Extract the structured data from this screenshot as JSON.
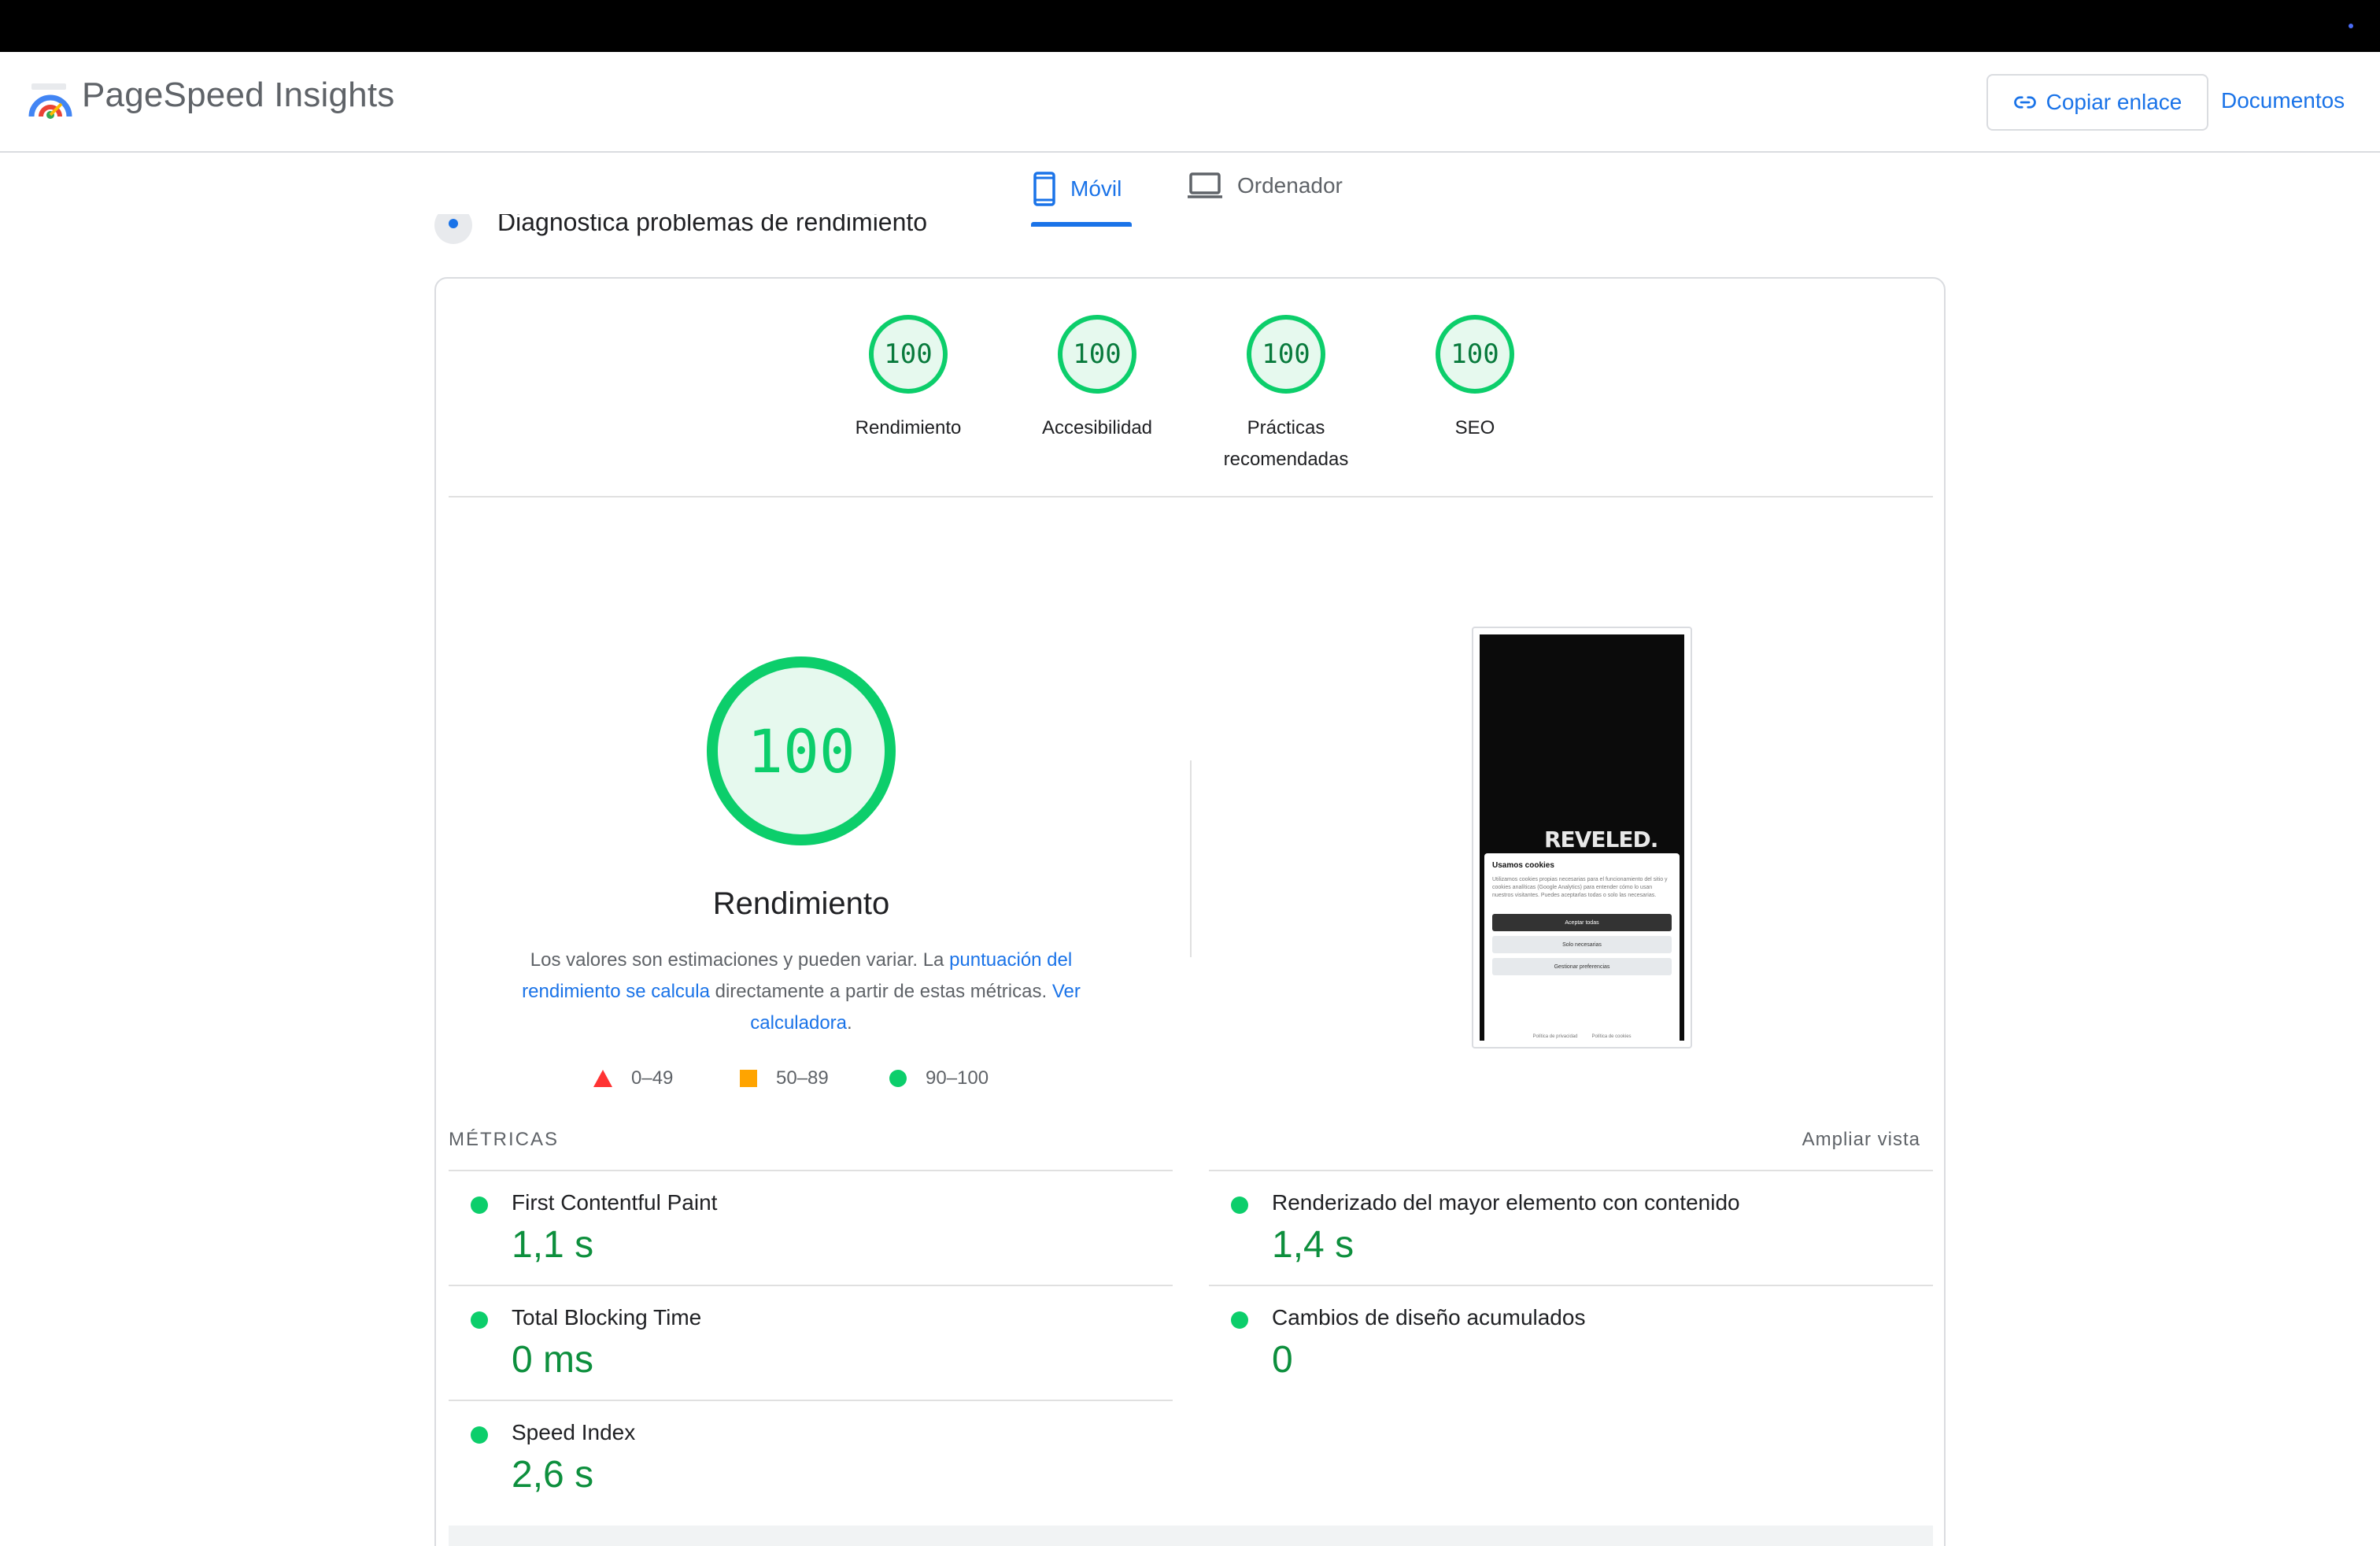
{
  "app": {
    "title": "PageSpeed Insights",
    "copy_link_label": "Copiar enlace",
    "docs_label": "Documentos"
  },
  "tabs": [
    {
      "label": "Móvil",
      "active": true,
      "icon": "smartphone-icon"
    },
    {
      "label": "Ordenador",
      "active": false,
      "icon": "laptop-icon"
    }
  ],
  "section_title": "Diagnostica problemas de rendimiento",
  "scores": [
    {
      "value": "100",
      "label": "Rendimiento"
    },
    {
      "value": "100",
      "label": "Accesibilidad"
    },
    {
      "value": "100",
      "label_line1": "Prácticas",
      "label_line2": "recomendadas"
    },
    {
      "value": "100",
      "label": "SEO"
    }
  ],
  "performance": {
    "score": "100",
    "title": "Rendimiento",
    "desc_part1": "Los valores son estimaciones y pueden variar. La ",
    "desc_link1": "puntuación del rendimiento se calcula",
    "desc_part2": " directamente a partir de estas métricas. ",
    "desc_link2": "Ver calculadora",
    "desc_part3": "."
  },
  "legend": [
    {
      "range": "0–49",
      "shape": "triangle",
      "color": "#ff3333"
    },
    {
      "range": "50–89",
      "shape": "square",
      "color": "#ffa400"
    },
    {
      "range": "90–100",
      "shape": "circle",
      "color": "#0cce6b"
    }
  ],
  "screenshot": {
    "brand": "REVELED.",
    "dialog_title": "Usamos cookies",
    "dialog_body": "Utilizamos cookies propias necesarias para el funcionamiento del sitio y cookies analíticas (Google Analytics) para entender cómo lo usan nuestros visitantes. Puedes aceptarlas todas o solo las necesarias.",
    "btn_accept": "Aceptar todas",
    "btn_necessary": "Solo necesarias",
    "btn_manage": "Gestionar preferencias",
    "link_privacy": "Política de privacidad",
    "link_cookies": "Política de cookies"
  },
  "metrics": {
    "title": "MÉTRICAS",
    "expand_label": "Ampliar vista",
    "left": [
      {
        "name": "First Contentful Paint",
        "value": "1,1 s"
      },
      {
        "name": "Total Blocking Time",
        "value": "0 ms"
      },
      {
        "name": "Speed Index",
        "value": "2,6 s"
      }
    ],
    "right": [
      {
        "name": "Renderizado del mayor elemento con contenido",
        "value": "1,4 s"
      },
      {
        "name": "Cambios de diseño acumulados",
        "value": "0"
      }
    ]
  },
  "colors": {
    "accent": "#1a73e8",
    "pass": "#0cce6b",
    "pass_text": "#0d8f3d"
  }
}
